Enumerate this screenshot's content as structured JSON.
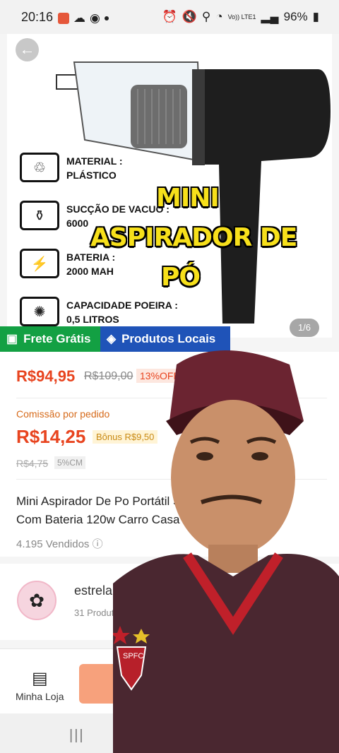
{
  "status_bar": {
    "time": "20:16",
    "network_label": "Vo)) LTE1",
    "battery": "96%"
  },
  "product_image": {
    "back_label": "←",
    "features": [
      {
        "icon": "bottle-icon",
        "line1": "MATERIAL :",
        "line2": "PLÁSTICO"
      },
      {
        "icon": "vacuum-icon",
        "line1": "SUCÇÃO DE VACUO :",
        "line2": "6000"
      },
      {
        "icon": "battery-icon",
        "line1": "BATERIA :",
        "line2": "2000 MAH"
      },
      {
        "icon": "dust-icon",
        "line1": "CAPACIDADE POEIRA :",
        "line2": "0,5 LITROS"
      }
    ],
    "overlay_line1": "MINI",
    "overlay_line2": "ASPIRADOR DE",
    "overlay_line3": "PÓ",
    "counter": "1/6"
  },
  "badges": {
    "free_shipping": "Frete Grátis",
    "local_products": "Produtos Locais"
  },
  "pricing": {
    "price": "R$94,95",
    "old_price": "R$109,00",
    "discount": "13%OFF"
  },
  "commission": {
    "label": "Comissão por pedido",
    "value": "R$14,25",
    "bonus": "Bônus R$9,50",
    "old_value": "R$4,75",
    "cm_rate": "5%CM"
  },
  "product": {
    "title_line1": "Mini Aspirador De Po Portátil Sem Fio",
    "title_line2": "Com Bateria 120w Carro Casa",
    "sold": "4.195 Vendidos"
  },
  "seller": {
    "name": "estrela",
    "sub": "31 Produtos"
  },
  "bottom": {
    "store_label": "Minha Loja"
  },
  "colors": {
    "price": "#e8441f",
    "free_shipping_bg": "#13a043",
    "local_bg": "#1f53b8",
    "overlay_text": "#f7e01b",
    "cta": "#f7a17c"
  }
}
